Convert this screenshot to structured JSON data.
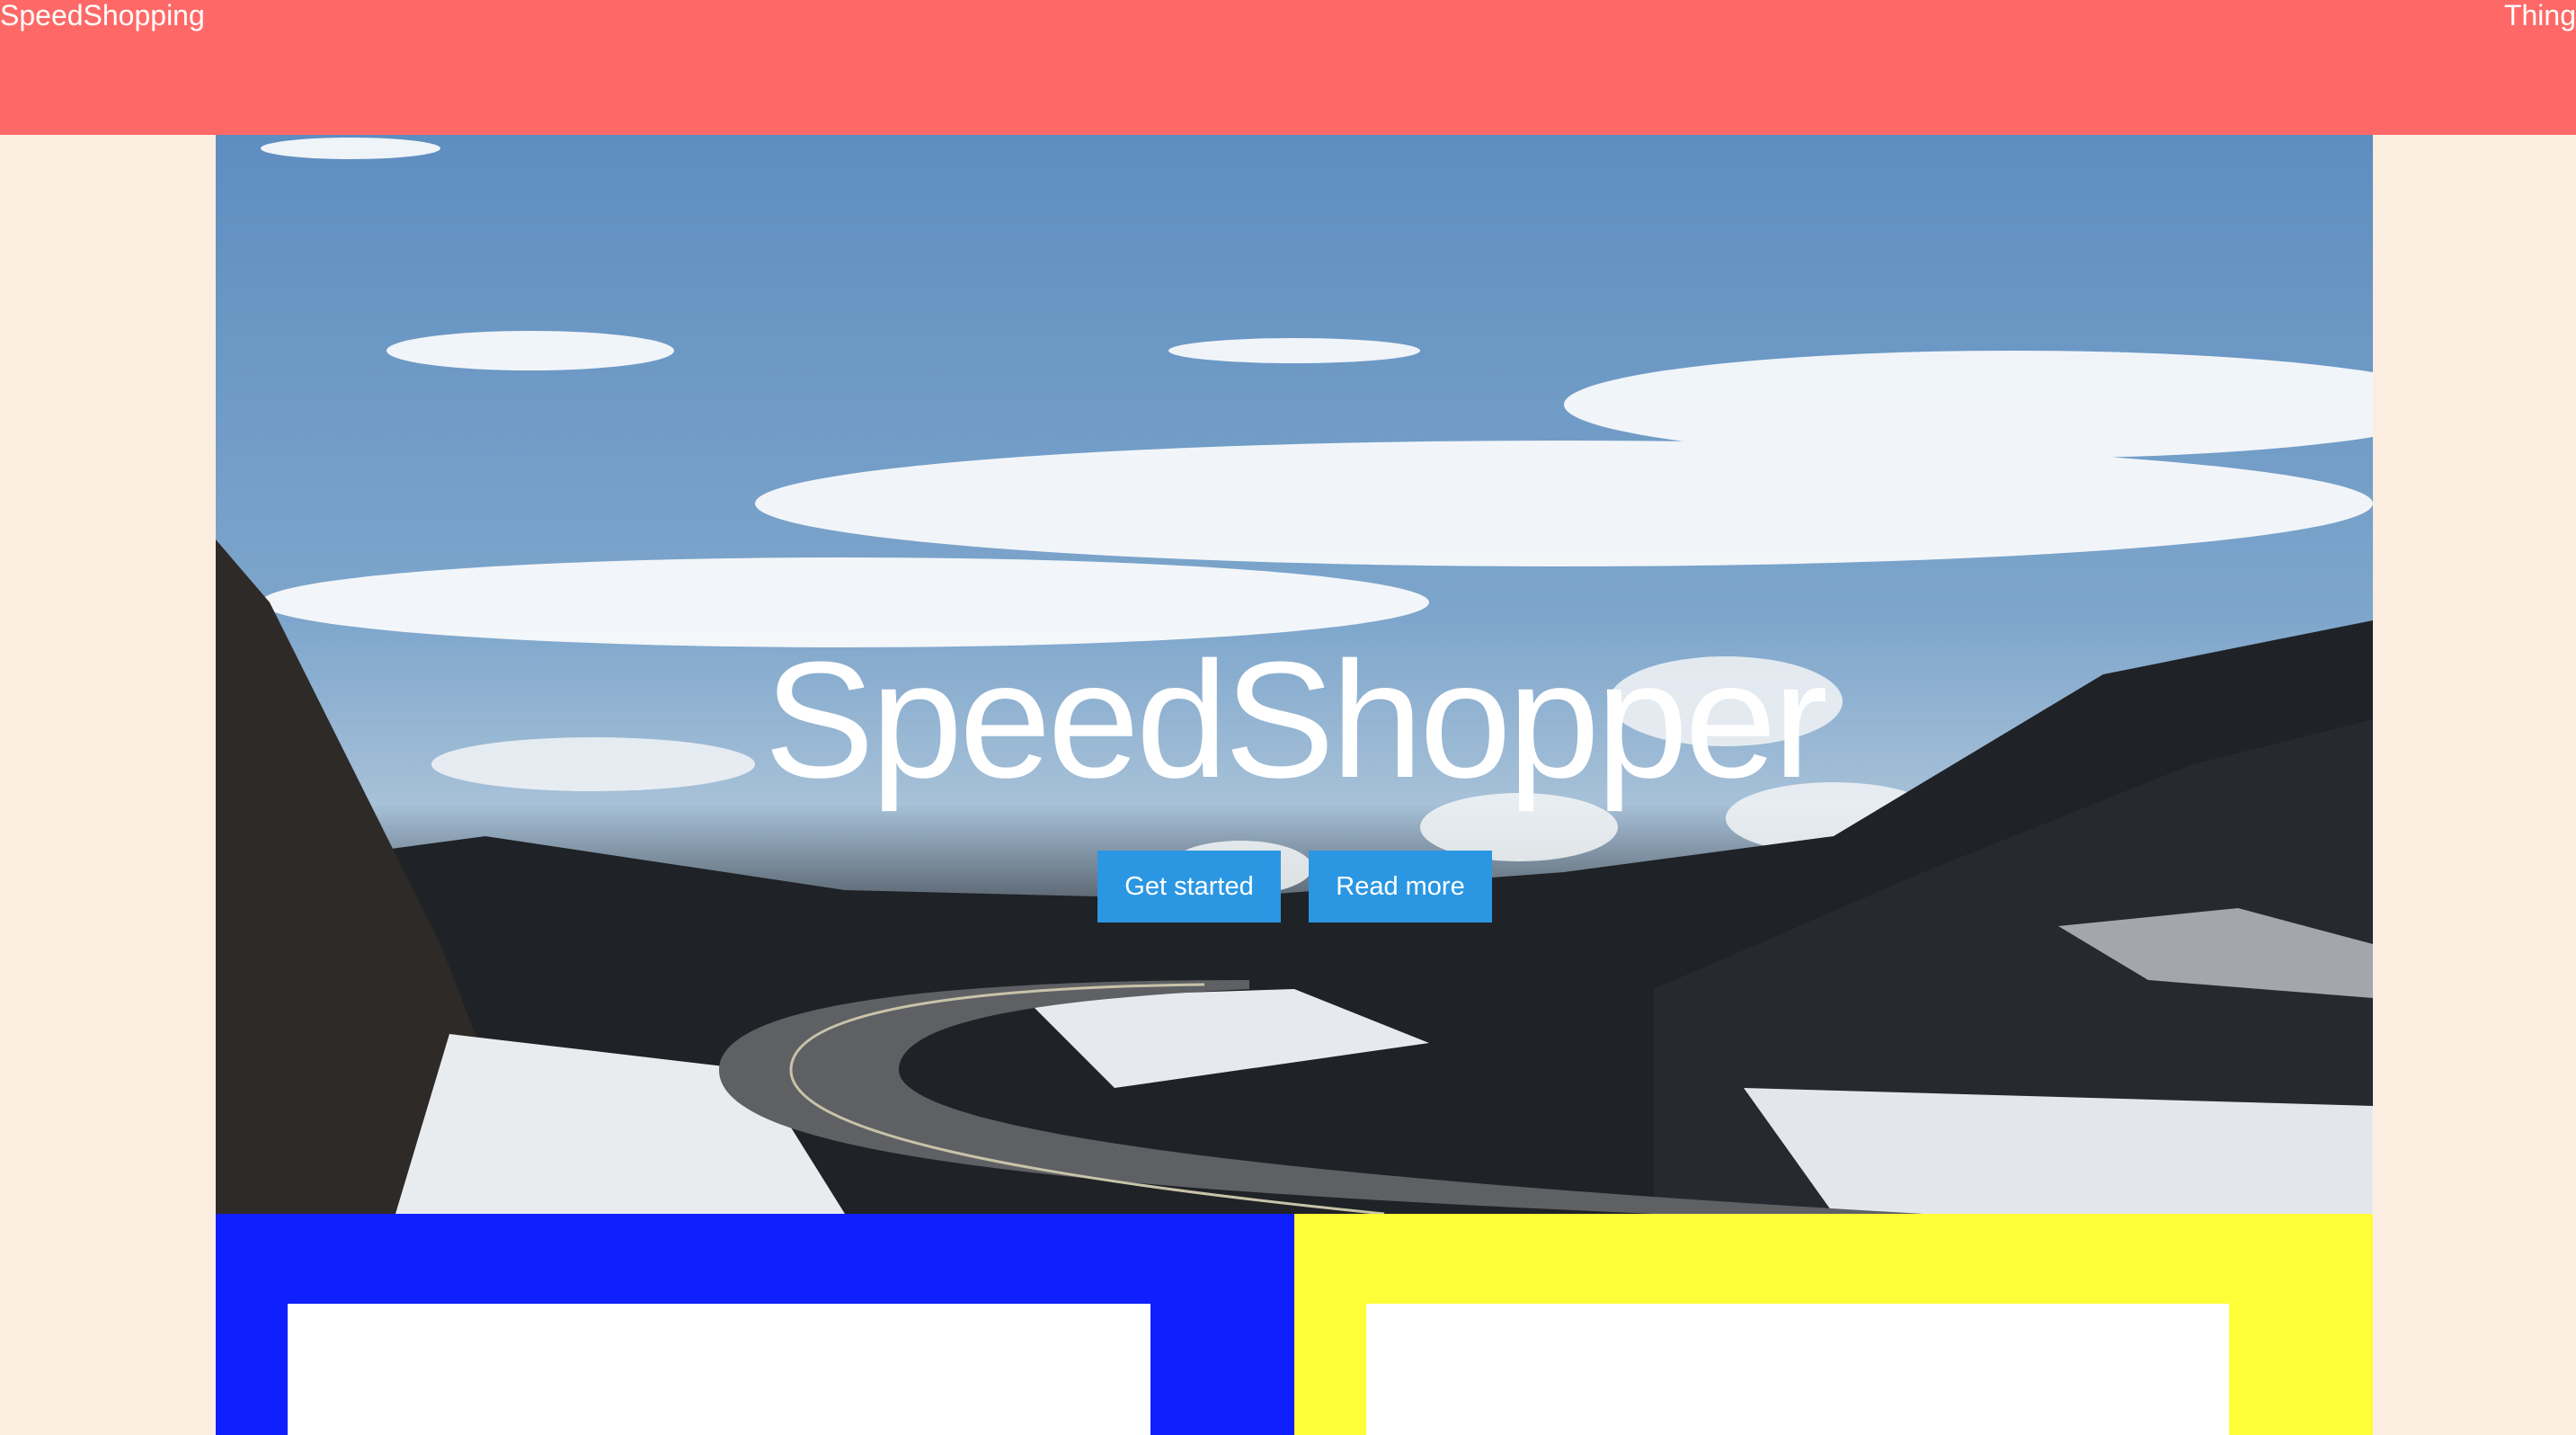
{
  "header": {
    "brand": "SpeedShopping",
    "nav_item": "Thing"
  },
  "hero": {
    "title": "SpeedShopper",
    "image_description": "snowy mountain road under blue sky with clouds",
    "buttons": {
      "get_started": "Get started",
      "read_more": "Read more"
    }
  },
  "colors": {
    "header_bg": "#fe6967",
    "page_bg": "#fcede1",
    "button_bg": "#2b97e2",
    "panel_left": "#101ffe",
    "panel_right": "#fffc38",
    "card_bg": "#ffffff"
  }
}
